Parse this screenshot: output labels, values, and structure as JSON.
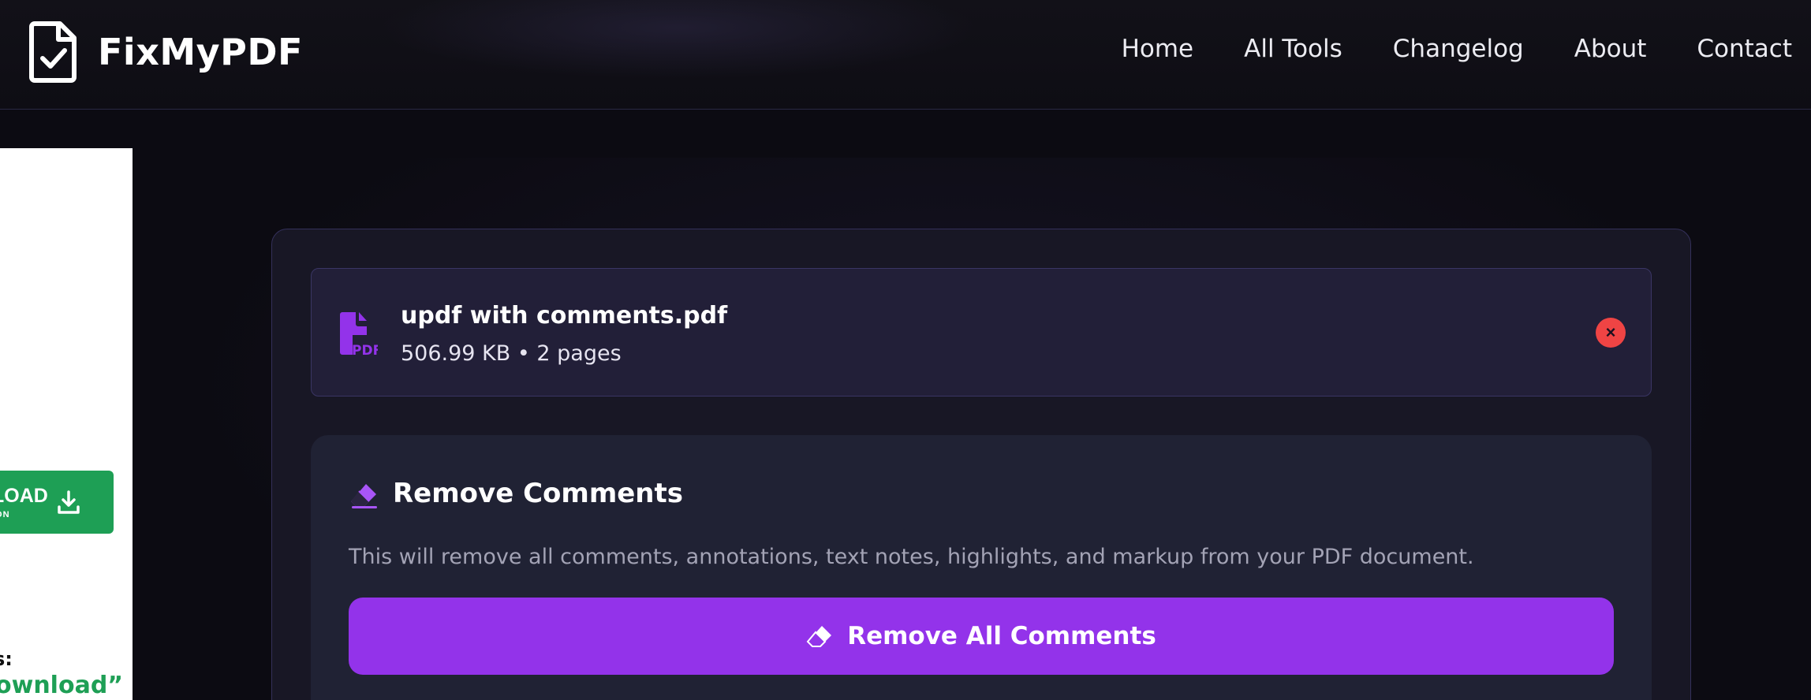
{
  "header": {
    "brand_name": "FixMyPDF",
    "brand_icon": "file-check-icon",
    "nav": [
      "Home",
      "All Tools",
      "Changelog",
      "About",
      "Contact"
    ]
  },
  "ad": {
    "button_main": "LOAD",
    "button_sub": "ION",
    "button_icon": "download-icon",
    "line1": "s:",
    "line2": "ownload”",
    "accent_color": "#1e9f55"
  },
  "file": {
    "icon": "pdf-file-icon",
    "name": "updf with comments.pdf",
    "meta": "506.99 KB • 2 pages",
    "remove_symbol": "×"
  },
  "options": {
    "icon": "eraser-icon",
    "title": "Remove Comments",
    "description": "This will remove all comments, annotations, text notes, highlights, and markup from your PDF document.",
    "action_label": "Remove All Comments",
    "action_icon": "eraser-icon"
  },
  "colors": {
    "accent": "#9333ea",
    "background": "#0c0b12",
    "danger": "#ef4444"
  }
}
